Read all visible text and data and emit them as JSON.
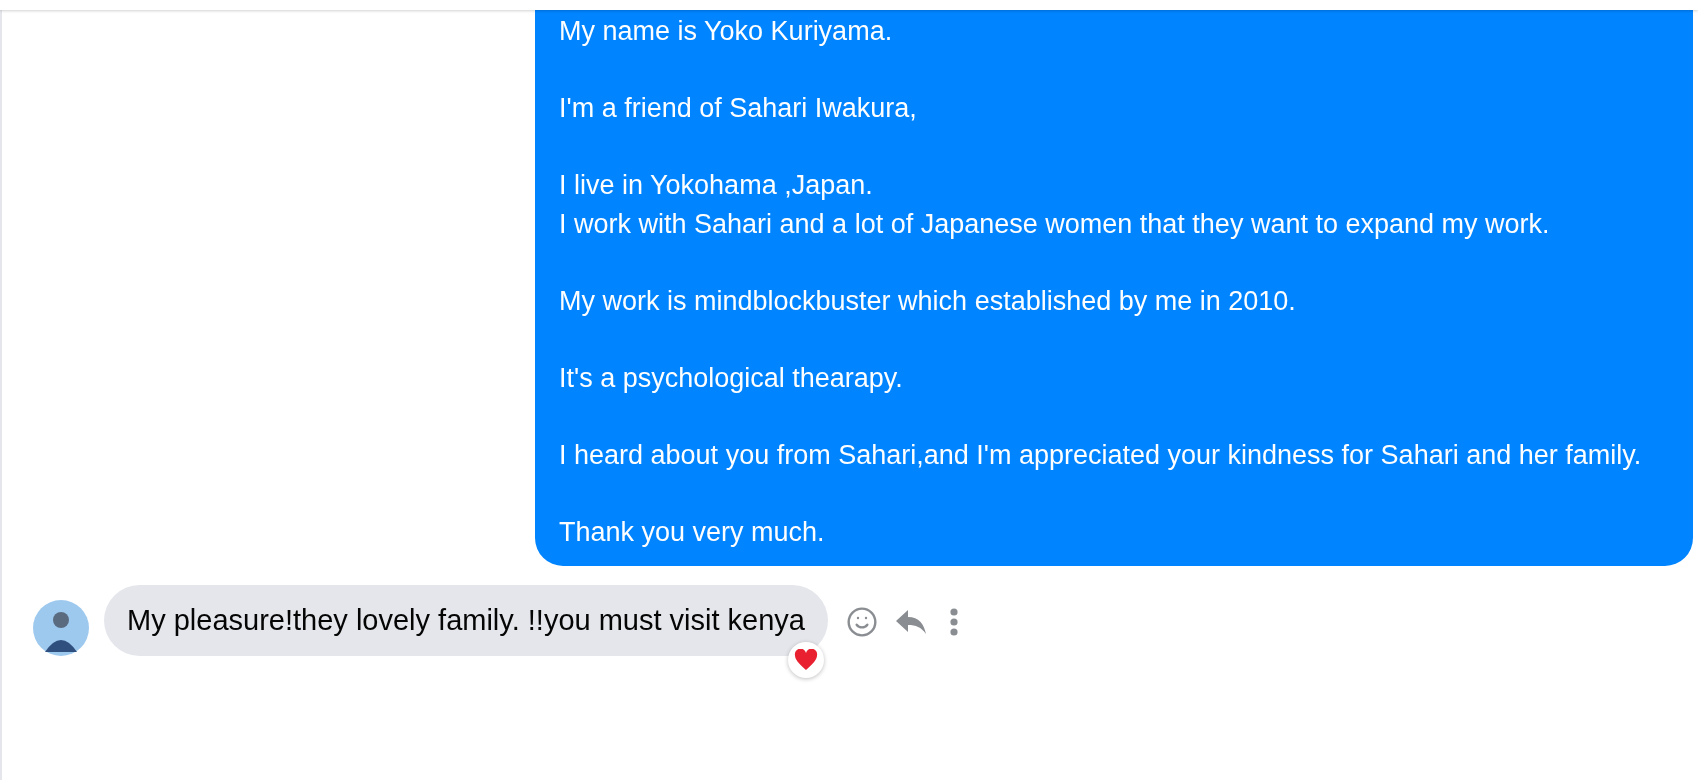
{
  "sent_message": {
    "paragraphs": [
      {
        "lines": [
          "My name is Yoko Kuriyama."
        ]
      },
      {
        "lines": [
          "I'm a friend of Sahari Iwakura,"
        ]
      },
      {
        "lines": [
          "I live in Yokohama ,Japan.",
          "I work with Sahari and a lot of Japanese women that they want to expand my work."
        ]
      },
      {
        "lines": [
          "My work is mindblockbuster which established by me in 2010."
        ]
      },
      {
        "lines": [
          "It's a psychological thearapy."
        ]
      },
      {
        "lines": [
          "I heard about you from Sahari,and I'm appreciated your kindness for Sahari and her family."
        ]
      },
      {
        "lines": [
          "Thank you very much."
        ]
      }
    ]
  },
  "received_message": {
    "text": "My pleasure!they lovely family. !!you must visit kenya",
    "reacted": true
  }
}
